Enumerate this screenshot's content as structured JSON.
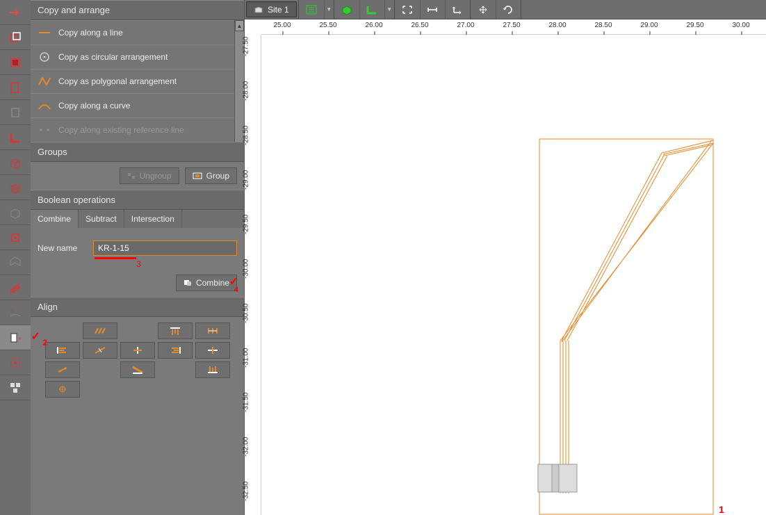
{
  "panel": {
    "title": "Copy and arrange",
    "items": [
      {
        "label": "Copy along a line",
        "disabled": false
      },
      {
        "label": "Copy as circular arrangement",
        "disabled": false
      },
      {
        "label": "Copy as polygonal arrangement",
        "disabled": false
      },
      {
        "label": "Copy along a curve",
        "disabled": false
      },
      {
        "label": "Copy along existing reference line",
        "disabled": true
      }
    ]
  },
  "groups": {
    "title": "Groups",
    "ungroup": "Ungroup",
    "group": "Group"
  },
  "boolops": {
    "title": "Boolean operations",
    "tabs": {
      "combine": "Combine",
      "subtract": "Subtract",
      "intersection": "Intersection"
    },
    "new_name_label": "New name",
    "new_name_value": "KR-1-15",
    "combine_btn": "Combine"
  },
  "align": {
    "title": "Align"
  },
  "toolbar": {
    "site_label": "Site 1"
  },
  "ruler_h": [
    "25.00",
    "25.50",
    "26.00",
    "26.50",
    "27.00",
    "27.50",
    "28.00",
    "28.50",
    "29.00",
    "29.50",
    "30.00"
  ],
  "ruler_v": [
    "-27.50",
    "-28.00",
    "-28.50",
    "-29.00",
    "-29.50",
    "-30.00",
    "-30.50",
    "-31.00",
    "-31.50",
    "-32.00",
    "-32.50"
  ],
  "annotations": {
    "a1": "1",
    "a2": "2",
    "a3": "3",
    "a4": "4"
  }
}
